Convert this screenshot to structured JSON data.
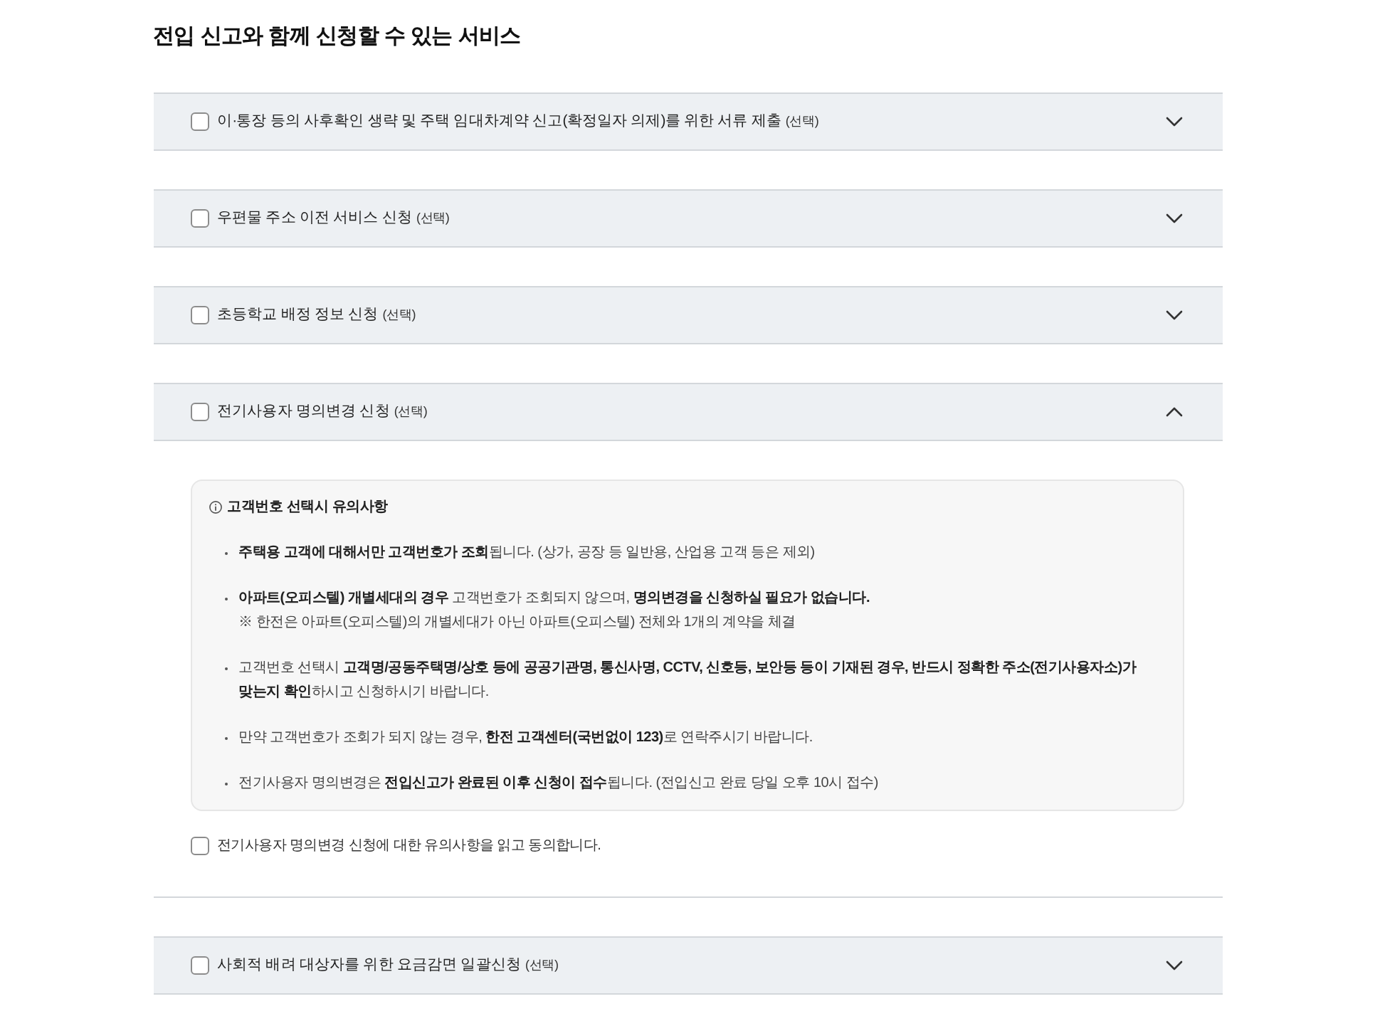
{
  "title": "전입 신고와 함께 신청할 수 있는 서비스",
  "services": [
    {
      "label": "이·통장 등의 사후확인 생략 및 주택 임대차계약 신고(확정일자 의제)를 위한 서류 제출",
      "tag": "(선택)",
      "checked": false,
      "expanded": false
    },
    {
      "label": "우편물 주소 이전 서비스 신청",
      "tag": "(선택)",
      "checked": false,
      "expanded": false
    },
    {
      "label": "초등학교 배정 정보 신청",
      "tag": "(선택)",
      "checked": false,
      "expanded": false
    },
    {
      "label": "전기사용자 명의변경 신청",
      "tag": "(선택)",
      "checked": false,
      "expanded": true,
      "notice": {
        "title": "고객번호 선택시 유의사항",
        "items": [
          {
            "text": "**주택용 고객에 대해서만 고객번호가 조회**됩니다. (상가, 공장 등 일반용, 산업용 고객 등은 제외)"
          },
          {
            "text": "**아파트(오피스텔) 개별세대의 경우** 고객번호가 조회되지 않으며, **명의변경을 신청하실 필요가 없습니다.**",
            "note": "※ 한전은 아파트(오피스텔)의 개별세대가 아닌 아파트(오피스텔) 전체와 1개의 계약을 체결"
          },
          {
            "text": "고객번호 선택시 **고객명/공동주택명/상호 등에 공공기관명, 통신사명, CCTV, 신호등, 보안등 등이 기재된 경우, 반드시 정확한 주소(전기사용자소)가 맞는지 확인**하시고 신청하시기 바랍니다."
          },
          {
            "text": "만약 고객번호가 조회가 되지 않는 경우, **한전 고객센터(국번없이 123)**로 연락주시기 바랍니다."
          },
          {
            "text": "전기사용자 명의변경은 **전입신고가 완료된 이후 신청이 접수**됩니다. (전입신고 완료 당일 오후 10시 접수)"
          }
        ]
      },
      "agreement": {
        "label": "전기사용자 명의변경 신청에 대한 유의사항을 읽고 동의합니다.",
        "checked": false
      }
    },
    {
      "label": "사회적 배려 대상자를 위한 요금감면 일괄신청",
      "tag": "(선택)",
      "checked": false,
      "expanded": false
    }
  ]
}
